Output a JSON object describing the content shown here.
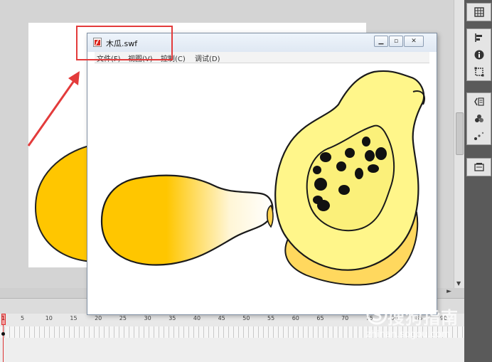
{
  "swf_window": {
    "title": "木瓜.swf",
    "menu": [
      "文件(F)",
      "视图(V)",
      "控制(C)",
      "调试(D)"
    ]
  },
  "timeline": {
    "current_frame": "1",
    "ruler": [
      "5",
      "10",
      "15",
      "20",
      "25",
      "30",
      "35",
      "40",
      "45",
      "50",
      "55",
      "60",
      "65",
      "70",
      "75",
      "80",
      "85",
      "90"
    ]
  },
  "watermark": {
    "main": "搜狗指南",
    "sub": "zhinan.sogou.com"
  },
  "colors": {
    "highlight": "#e33b3b",
    "papaya_flesh": "#ffee7a",
    "papaya_skin": "#ffc600",
    "seed": "#111111"
  },
  "icons": [
    "grid-icon",
    "align-icon",
    "info-icon",
    "transform-icon",
    "code-icon",
    "components-icon",
    "motion-icon",
    "library-icon",
    "flash-file-icon"
  ]
}
